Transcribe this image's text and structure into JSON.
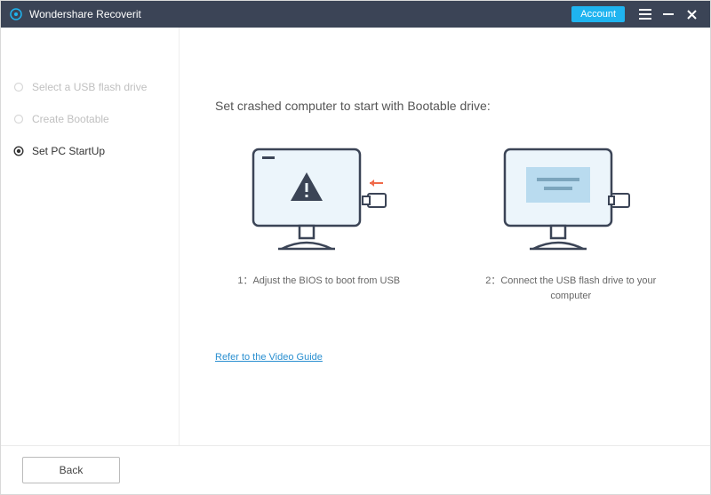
{
  "titlebar": {
    "app_name": "Wondershare Recoverit",
    "account_btn": "Account"
  },
  "sidebar": {
    "steps": [
      {
        "label": "Select a USB flash drive",
        "active": false
      },
      {
        "label": "Create Bootable",
        "active": false
      },
      {
        "label": "Set PC StartUp",
        "active": true
      }
    ]
  },
  "main": {
    "heading": "Set crashed computer to start with Bootable drive:",
    "step1_caption": "1：Adjust the BIOS to boot from USB",
    "step2_caption": "2：Connect the USB flash drive to your computer",
    "video_link": "Refer to the Video Guide"
  },
  "footer": {
    "back_btn": "Back"
  }
}
